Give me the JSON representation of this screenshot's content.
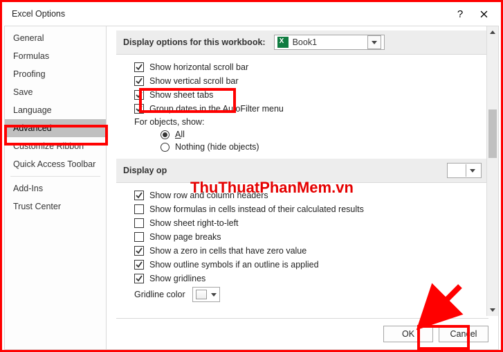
{
  "window": {
    "title": "Excel Options"
  },
  "sidebar": {
    "items": [
      {
        "label": "General"
      },
      {
        "label": "Formulas"
      },
      {
        "label": "Proofing"
      },
      {
        "label": "Save"
      },
      {
        "label": "Language"
      },
      {
        "label": "Advanced",
        "selected": true
      },
      {
        "label": "Customize Ribbon"
      },
      {
        "label": "Quick Access Toolbar"
      },
      {
        "label": "Add-Ins"
      },
      {
        "label": "Trust Center"
      }
    ]
  },
  "sections": {
    "workbook_header": "Display options for this workbook:",
    "workbook_value": "Book1",
    "worksheet_header": "Display op",
    "opts": {
      "show_h_scroll": "Show horizontal scroll bar",
      "show_v_scroll": "Show vertical scroll bar",
      "show_sheet_tabs": "Show sheet tabs",
      "group_dates": "Group dates in the AutoFilter menu",
      "for_objects": "For objects, show:",
      "radio_all": "All",
      "radio_nothing": "Nothing (hide objects)",
      "row_col_headers": "Show row and column headers",
      "show_formulas": "Show formulas in cells instead of their calculated results",
      "right_to_left": "Show sheet right-to-left",
      "page_breaks": "Show page breaks",
      "zero_value": "Show a zero in cells that have zero value",
      "outline_symbols": "Show outline symbols if an outline is applied",
      "gridlines": "Show gridlines",
      "gridline_color": "Gridline color"
    }
  },
  "buttons": {
    "ok": "OK",
    "cancel": "Cancel"
  },
  "watermark": "ThuThuatPhanMem.vn"
}
